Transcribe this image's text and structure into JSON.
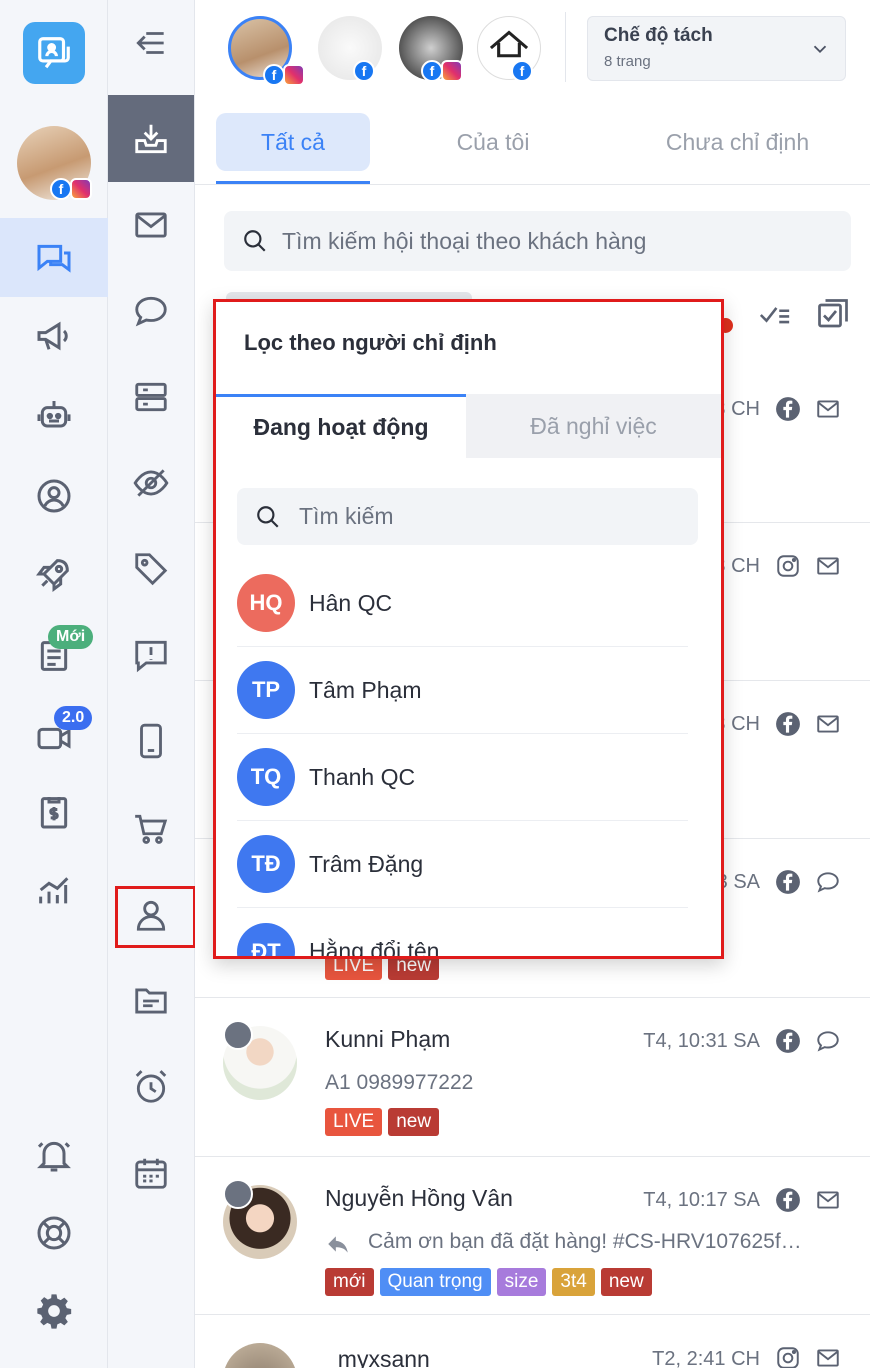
{
  "header": {
    "mode_title": "Chế độ tách",
    "mode_sub": "8 trang"
  },
  "tabs": [
    {
      "label": "Tất cả",
      "active": true
    },
    {
      "label": "Của tôi"
    },
    {
      "label": "Chưa chỉ định"
    }
  ],
  "search": {
    "placeholder": "Tìm kiếm hội thoại theo khách hàng"
  },
  "rail": {
    "badge_new": "Mới",
    "badge_version": "2.0"
  },
  "conversations": [
    {
      "time": "3 CH",
      "channel": "facebook",
      "action": "mail-icon"
    },
    {
      "time": "3 CH",
      "channel": "instagram",
      "action": "mail-icon"
    },
    {
      "time": "3 CH",
      "channel": "facebook",
      "action": "mail-icon"
    },
    {
      "time": "3 SA",
      "channel": "facebook",
      "action": "comment-icon",
      "tags": [
        "LIVE",
        "new"
      ]
    },
    {
      "name": "Kunni Phạm",
      "time": "T4, 10:31 SA",
      "channel": "facebook",
      "action": "comment-icon",
      "preview": "A1 0989977222",
      "tags": [
        "LIVE",
        "new"
      ]
    },
    {
      "name": "Nguyễn Hồng Vân",
      "time": "T4, 10:17 SA",
      "channel": "facebook",
      "action": "mail-icon",
      "preview": "Cảm ơn bạn đã đặt hàng! #CS-HRV107625f…",
      "tags": [
        "mới",
        "Quan trọng",
        "size",
        "3t4",
        "new"
      ]
    },
    {
      "name": "_myxsann_",
      "time": "T2, 2:41 CH",
      "channel": "instagram",
      "action": "mail-icon"
    }
  ],
  "tag_colors": {
    "LIVE": "#e8553e",
    "new": "#b93b34",
    "mới": "#b93b34",
    "Quan trọng": "#4f8ef5",
    "size": "#a77bdc",
    "3t4": "#d9a33a"
  },
  "popup": {
    "title": "Lọc theo người chỉ định",
    "tab_active": "Đang hoạt động",
    "tab_inactive": "Đã nghỉ việc",
    "search_placeholder": "Tìm kiếm",
    "agents": [
      {
        "initials": "HQ",
        "name": "Hân QC",
        "color": "#ec6b5e"
      },
      {
        "initials": "TP",
        "name": "Tâm Phạm",
        "color": "#3f78f0"
      },
      {
        "initials": "TQ",
        "name": "Thanh QC",
        "color": "#3f78f0"
      },
      {
        "initials": "TĐ",
        "name": "Trâm Đặng",
        "color": "#3f78f0"
      },
      {
        "initials": "ĐT",
        "name": "Hằng đổi tên",
        "color": "#3f78f0"
      }
    ]
  },
  "colors": {
    "accent": "#3b82f6",
    "highlight": "#e01b1b"
  }
}
